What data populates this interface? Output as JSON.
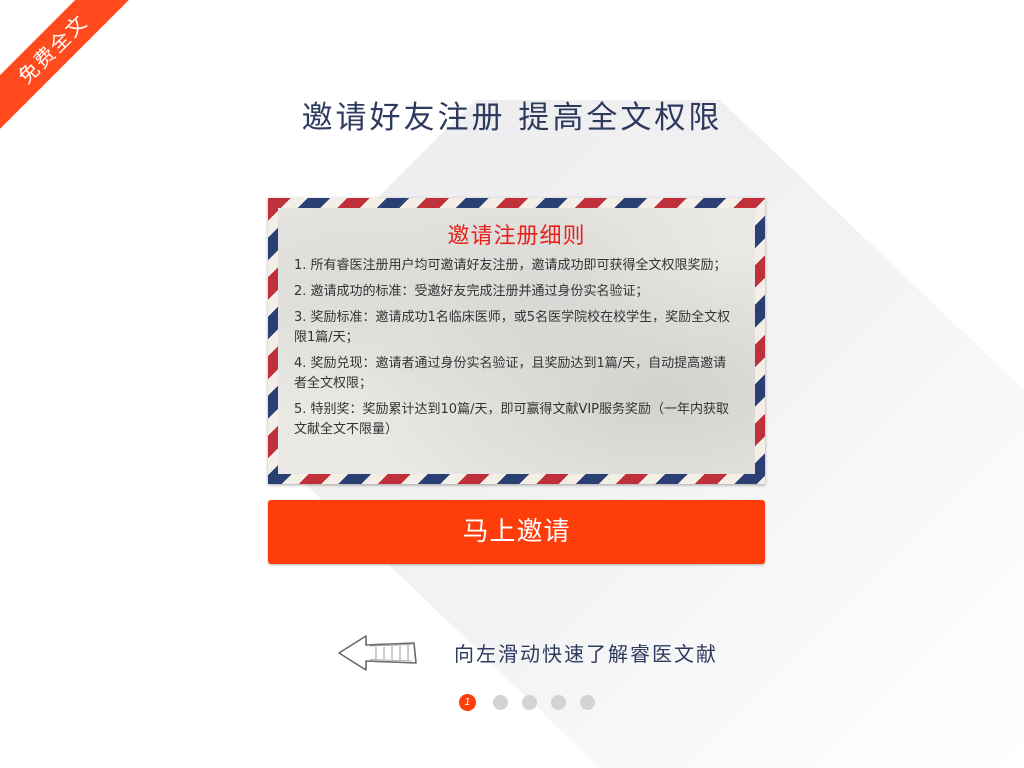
{
  "ribbon": {
    "label": "免费全文"
  },
  "header": {
    "title": "邀请好友注册 提高全文权限"
  },
  "envelope": {
    "title": "邀请注册细则",
    "rules": [
      "1. 所有睿医注册用户均可邀请好友注册，邀请成功即可获得全文权限奖励；",
      "2. 邀请成功的标准：受邀好友完成注册并通过身份实名验证；",
      "3. 奖励标准：邀请成功1名临床医师，或5名医学院校在校学生，奖励全文权限1篇/天；",
      "4. 奖励兑现：邀请者通过身份实名验证，且奖励达到1篇/天，自动提高邀请者全文权限；",
      "5. 特别奖：奖励累计达到10篇/天，即可赢得文献VIP服务奖励（一年内获取文献全文不限量）"
    ]
  },
  "invite_button": {
    "label": "马上邀请"
  },
  "swipe_hint": {
    "icon": "arrow-left-icon",
    "text": "向左滑动快速了解睿医文献"
  },
  "pager": {
    "active_label": "1",
    "total": 5,
    "active_index": 0
  },
  "colors": {
    "accent": "#ff3d0a",
    "title_navy": "#2e3b5f",
    "envelope_red": "#c0303a",
    "envelope_blue": "#2a3f73",
    "rule_title_red": "#e8211d"
  }
}
